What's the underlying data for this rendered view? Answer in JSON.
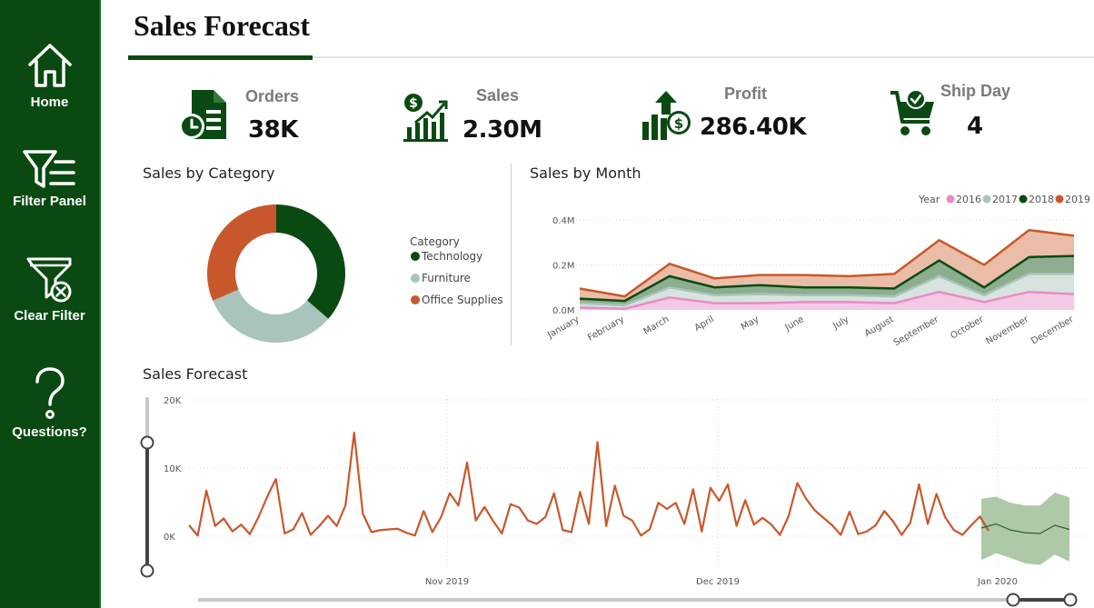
{
  "sidebar": {
    "items": [
      {
        "label": "Home",
        "icon": "home-icon"
      },
      {
        "label": "Filter Panel",
        "icon": "filter-panel-icon"
      },
      {
        "label": "Clear Filter",
        "icon": "clear-filter-icon"
      },
      {
        "label": "Questions?",
        "icon": "question-icon"
      }
    ]
  },
  "page": {
    "title": "Sales Forecast"
  },
  "kpis": [
    {
      "label": "Orders",
      "value": "38K",
      "icon": "orders-icon"
    },
    {
      "label": "Sales",
      "value": "2.30M",
      "icon": "sales-icon"
    },
    {
      "label": "Profit",
      "value": "286.40K",
      "icon": "profit-icon"
    },
    {
      "label": "Ship Day",
      "value": "4",
      "icon": "shipping-cart-icon"
    }
  ],
  "colors": {
    "dark_green": "#0a4a12",
    "sage": "#a8c4bc",
    "orange": "#c8582b",
    "pink": "#e98bc9",
    "forecast": "#9fbf98"
  },
  "chart_data": [
    {
      "type": "pie",
      "title": "Sales by Category",
      "legend_title": "Category",
      "categories": [
        "Technology",
        "Furniture",
        "Office Supplies"
      ],
      "values": [
        36.4,
        32.2,
        31.4
      ],
      "colors": [
        "#0a4a12",
        "#a8c4bc",
        "#c8582b"
      ]
    },
    {
      "type": "area",
      "title": "Sales by Month",
      "legend_title": "Year",
      "categories": [
        "January",
        "February",
        "March",
        "April",
        "May",
        "June",
        "July",
        "August",
        "September",
        "October",
        "November",
        "December"
      ],
      "ytick_labels": [
        "0.0M",
        "0.2M",
        "0.4M"
      ],
      "ylim": [
        0,
        0.4
      ],
      "series": [
        {
          "name": "2016",
          "color": "#e98bc9",
          "values": [
            0.01,
            0.005,
            0.055,
            0.03,
            0.03,
            0.035,
            0.035,
            0.03,
            0.08,
            0.035,
            0.08,
            0.07
          ]
        },
        {
          "name": "2017",
          "color": "#a8c4bc",
          "values": [
            0.03,
            0.02,
            0.1,
            0.065,
            0.07,
            0.065,
            0.065,
            0.06,
            0.15,
            0.065,
            0.16,
            0.16
          ]
        },
        {
          "name": "2018",
          "color": "#0a4a12",
          "values": [
            0.05,
            0.04,
            0.15,
            0.1,
            0.11,
            0.1,
            0.1,
            0.095,
            0.22,
            0.1,
            0.235,
            0.24
          ]
        },
        {
          "name": "2019",
          "color": "#c8582b",
          "values": [
            0.095,
            0.06,
            0.205,
            0.14,
            0.155,
            0.155,
            0.15,
            0.16,
            0.31,
            0.2,
            0.355,
            0.33
          ]
        }
      ]
    },
    {
      "type": "line",
      "title": "Sales Forecast",
      "xtick_labels": [
        "Nov 2019",
        "Dec 2019",
        "Jan 2020"
      ],
      "ytick_labels": [
        "0K",
        "10K",
        "20K"
      ],
      "ylim": [
        0,
        20000
      ],
      "series": [
        {
          "name": "",
          "color": "#c8582b",
          "values": [
            1600,
            100,
            6700,
            1500,
            2600,
            700,
            1700,
            300,
            2800,
            5800,
            8400,
            400,
            1000,
            3400,
            200,
            1500,
            3000,
            1500,
            4500,
            15200,
            3300,
            600,
            900,
            1000,
            1100,
            500,
            100,
            3700,
            600,
            2800,
            6300,
            4500,
            10800,
            2300,
            4300,
            2200,
            400,
            4700,
            4200,
            2300,
            1800,
            2800,
            6300,
            900,
            600,
            6500,
            1800,
            13800,
            1500,
            7400,
            3000,
            2300,
            100,
            1000,
            4900,
            4000,
            4900,
            1800,
            6900,
            700,
            7100,
            5200,
            7600,
            1500,
            5300,
            1700,
            2700,
            1700,
            200,
            3000,
            7800,
            5500,
            3800,
            2700,
            1600,
            200,
            3600,
            300,
            700,
            1600,
            3700,
            2200,
            200,
            2000,
            7600,
            1800,
            6200,
            2800,
            900,
            200,
            1600,
            2900,
            800
          ]
        },
        {
          "name": "Forecast",
          "color": "#2f5e2f",
          "values": [
            1200,
            1800,
            900,
            500,
            400,
            1600,
            1000
          ],
          "lower": [
            -3500,
            -2500,
            -3200,
            -4000,
            -4200,
            -2700,
            -3700
          ],
          "upper": [
            5500,
            5800,
            4900,
            4500,
            4500,
            6400,
            5700
          ]
        }
      ]
    }
  ]
}
